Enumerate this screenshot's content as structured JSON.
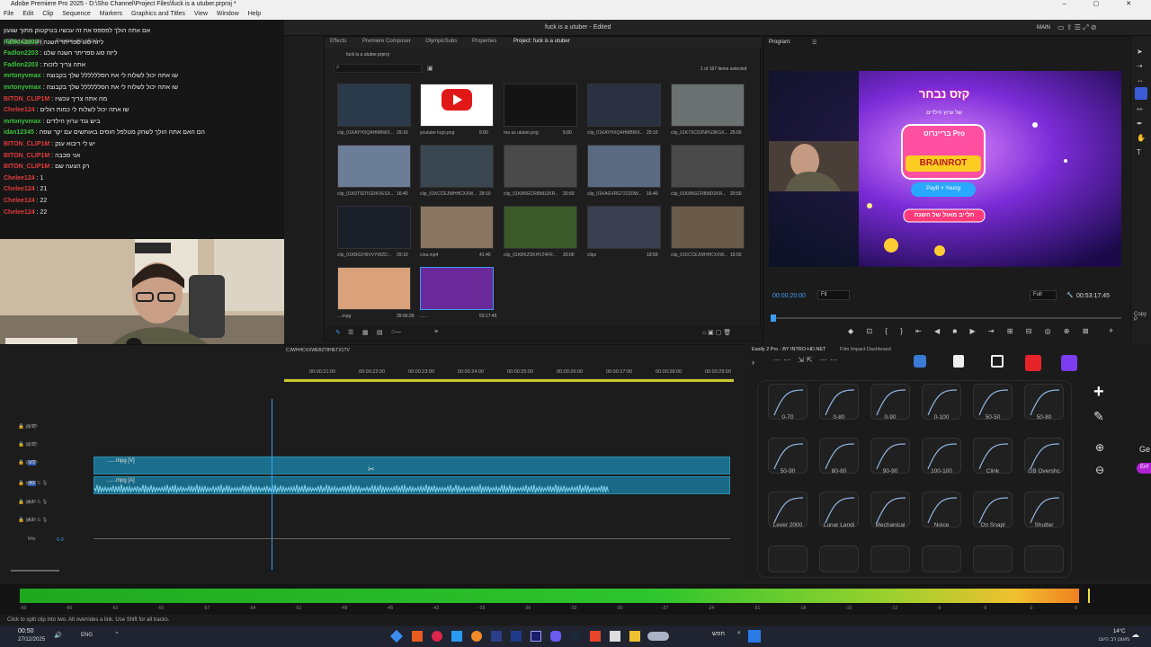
{
  "window": {
    "app_title": "Adobe Premiere Pro 2025 - D:\\Sho Channel\\Project Files\\fuck is a utuber.prproj *",
    "project_title": "fuck is a utuber - Edited",
    "workspace": "MAIN"
  },
  "menu": [
    "File",
    "Edit",
    "Clip",
    "Sequence",
    "Markers",
    "Graphics and Titles",
    "View",
    "Window",
    "Help"
  ],
  "chat": {
    "lines": [
      {
        "user": "",
        "text": "אם אתה הולך לפספס את זה עכשיו בטיקטוק מתוך שגעון"
      },
      {
        "user": "Fadlon2203",
        "text": "ליזה סוג ספריתר השנה"
      },
      {
        "user": "Fadlon2203",
        "text": "ליזה סוג ספריתר השנה שלנו"
      },
      {
        "user": "Fadlon2203",
        "text": "אתה צריך לזכות"
      },
      {
        "user": "mrtonyvmax",
        "text": "שו אתה יכול לשלוח לי את הסלללללל שלך בקבוצה"
      },
      {
        "user": "mrtonyvmax",
        "text": "שו אתה יכול לשלוח לי את הסלללללל שלך בקבוצה"
      },
      {
        "user": "BITON_CLIP1M",
        "text": "מה אתה צריך עכשיו",
        "red": true
      },
      {
        "user": "Chelee124",
        "text": "שו אתה יכול לשלוח לי כמות רגלים",
        "red": true
      },
      {
        "user": "mrtonyvmax",
        "text": "ביש גנד ערוץ הילדים"
      },
      {
        "user": "idan12345",
        "text": "הם האם אתה הולך לשחק מטלפל חוסים באותשים עם יקר שפה"
      },
      {
        "user": "BITON_CLIP1M",
        "text": "יש לי ריבוא ענק",
        "red": true
      },
      {
        "user": "BITON_CLIP1M",
        "text": "אני סבבה",
        "red": true
      },
      {
        "user": "BITON_CLIP1M",
        "text": "רק הצעה שם",
        "red": true
      },
      {
        "user": "Chelee124",
        "text": "1",
        "red": true
      },
      {
        "user": "Chelee124",
        "text": "21",
        "red": true
      },
      {
        "user": "Chelee124",
        "text": "22",
        "red": true
      },
      {
        "user": "Chelee124",
        "text": "22",
        "red": true
      }
    ]
  },
  "project_panel": {
    "tabs": [
      "Effects",
      "Premiere Composer",
      "OlympicSubs",
      "Properties",
      "Project: fuck is a utuber"
    ],
    "path": "fuck is a utuber.prproj",
    "selection": "1 of 167 items selected",
    "items": [
      {
        "name": "clip_01KAYHXQAHMBWX...",
        "dur": "29:10",
        "color": "#2a3a4a"
      },
      {
        "name": "youtube logo.png",
        "dur": "5:00",
        "color": "#ffffff"
      },
      {
        "name": "ma as utuber.png",
        "dur": "5:00",
        "color": "#141414"
      },
      {
        "name": "clip_01KAYHXQAHMBWX...",
        "dur": "29:10",
        "color": "#2b3140"
      },
      {
        "name": "clip_01K7SCD2NPG3KGX...",
        "dur": "25:00",
        "color": "#6b7070"
      },
      {
        "name": "clip_01K9TSDTGDKVESX...",
        "dur": "16:40",
        "color": "#6c7d98"
      },
      {
        "name": "clip_01KCCEJWHHCXXW...",
        "dur": "29:10",
        "color": "#3a4650"
      },
      {
        "name": "clip_01K8NGCR8MDZKR...",
        "dur": "20:50",
        "color": "#4a4a4a"
      },
      {
        "name": "clip_01KAGVRG7222DW...",
        "dur": "16:40",
        "color": "#5a6a80"
      },
      {
        "name": "clip_01K8NGCR8MDZKR...",
        "dur": "20:50",
        "color": "#4a4a4a"
      },
      {
        "name": "clip_01KB61H6VVYWZD...",
        "dur": "29:10",
        "color": "#1a1f2a"
      },
      {
        "name": "cina.mp4",
        "dur": "41:40",
        "color": "#8a7560"
      },
      {
        "name": "clip_01KBKZSKHV24FR...",
        "dur": "20:00",
        "color": "#3a5a2a"
      },
      {
        "name": "clips",
        "dur": "19:59",
        "color": "#3a4050"
      },
      {
        "name": "clip_01KCCEJWHHCXXW...",
        "dur": "15:02",
        "color": "#6a5a4a"
      },
      {
        "name": "....mpg",
        "dur": "39:56:39",
        "color": "#d9a27a"
      },
      {
        "name": "......",
        "dur": "53:17:45",
        "color": "#6a2a9a"
      }
    ]
  },
  "program": {
    "title": "Program:",
    "timecode": "00:00:20:00",
    "fit": "Fit",
    "quality": "Full",
    "duration": "00:53:17:45",
    "overlay": {
      "line1": "קזס נבחר",
      "line2": "של ערוץ הילדים",
      "line3": "בריינרוט Pro",
      "brand": "BRAINROT",
      "pill": "PayB × Young",
      "bottom": "הלייב מאול של השנה"
    }
  },
  "timeline": {
    "sequence_name": "CJWHHCXXWEB2T8HETX1TV",
    "ruler": [
      "00:00:21:00",
      "00:00:22:00",
      "00:00:23:00",
      "00:00:24:00",
      "00:00:25:00",
      "00:00:26:00",
      "00:00:27:00",
      "00:00:28:00",
      "00:00:29:00"
    ],
    "tracks": [
      "V3",
      "V2",
      "V1",
      "A1",
      "A2",
      "A3",
      "Mix"
    ],
    "mix_value": "0.0",
    "video_clip": "......mpg [V]",
    "audio_clip": "......mpg [A]"
  },
  "motion_bro": {
    "tabs": [
      "Easily 2 Pro - BY INTRO-HD.NET",
      "Film Impact Dashboard"
    ],
    "presets": [
      "0-70",
      "0-80",
      "0-90",
      "0-100",
      "50-50",
      "50-80",
      "50-90",
      "80-80",
      "90-90",
      "100-100",
      "Clink",
      "GB Overshc",
      "Lever 2000",
      "Lunar Landi",
      "Mechanical",
      "Noice",
      "On Snapl",
      "Shutter"
    ]
  },
  "side_right": {
    "copy_label": "Copy P",
    "ge": "Ge",
    "enter": "Enf"
  },
  "meter_scale": [
    "-69",
    "-66",
    "-63",
    "-60",
    "-57",
    "-54",
    "-51",
    "-48",
    "-45",
    "-42",
    "-39",
    "-36",
    "-33",
    "-30",
    "-27",
    "-24",
    "-21",
    "-18",
    "-15",
    "-12",
    "-9",
    "-6",
    "-3",
    "0"
  ],
  "status": "Click to split clip into two. Alt overrides a link. Use Shift for all tracks.",
  "taskbar": {
    "time": "00:50",
    "date": "27/12/2025",
    "lang": "ENG",
    "weather_temp": "14°C",
    "weather_text": "מעונן רב היום",
    "search": "חפש"
  }
}
